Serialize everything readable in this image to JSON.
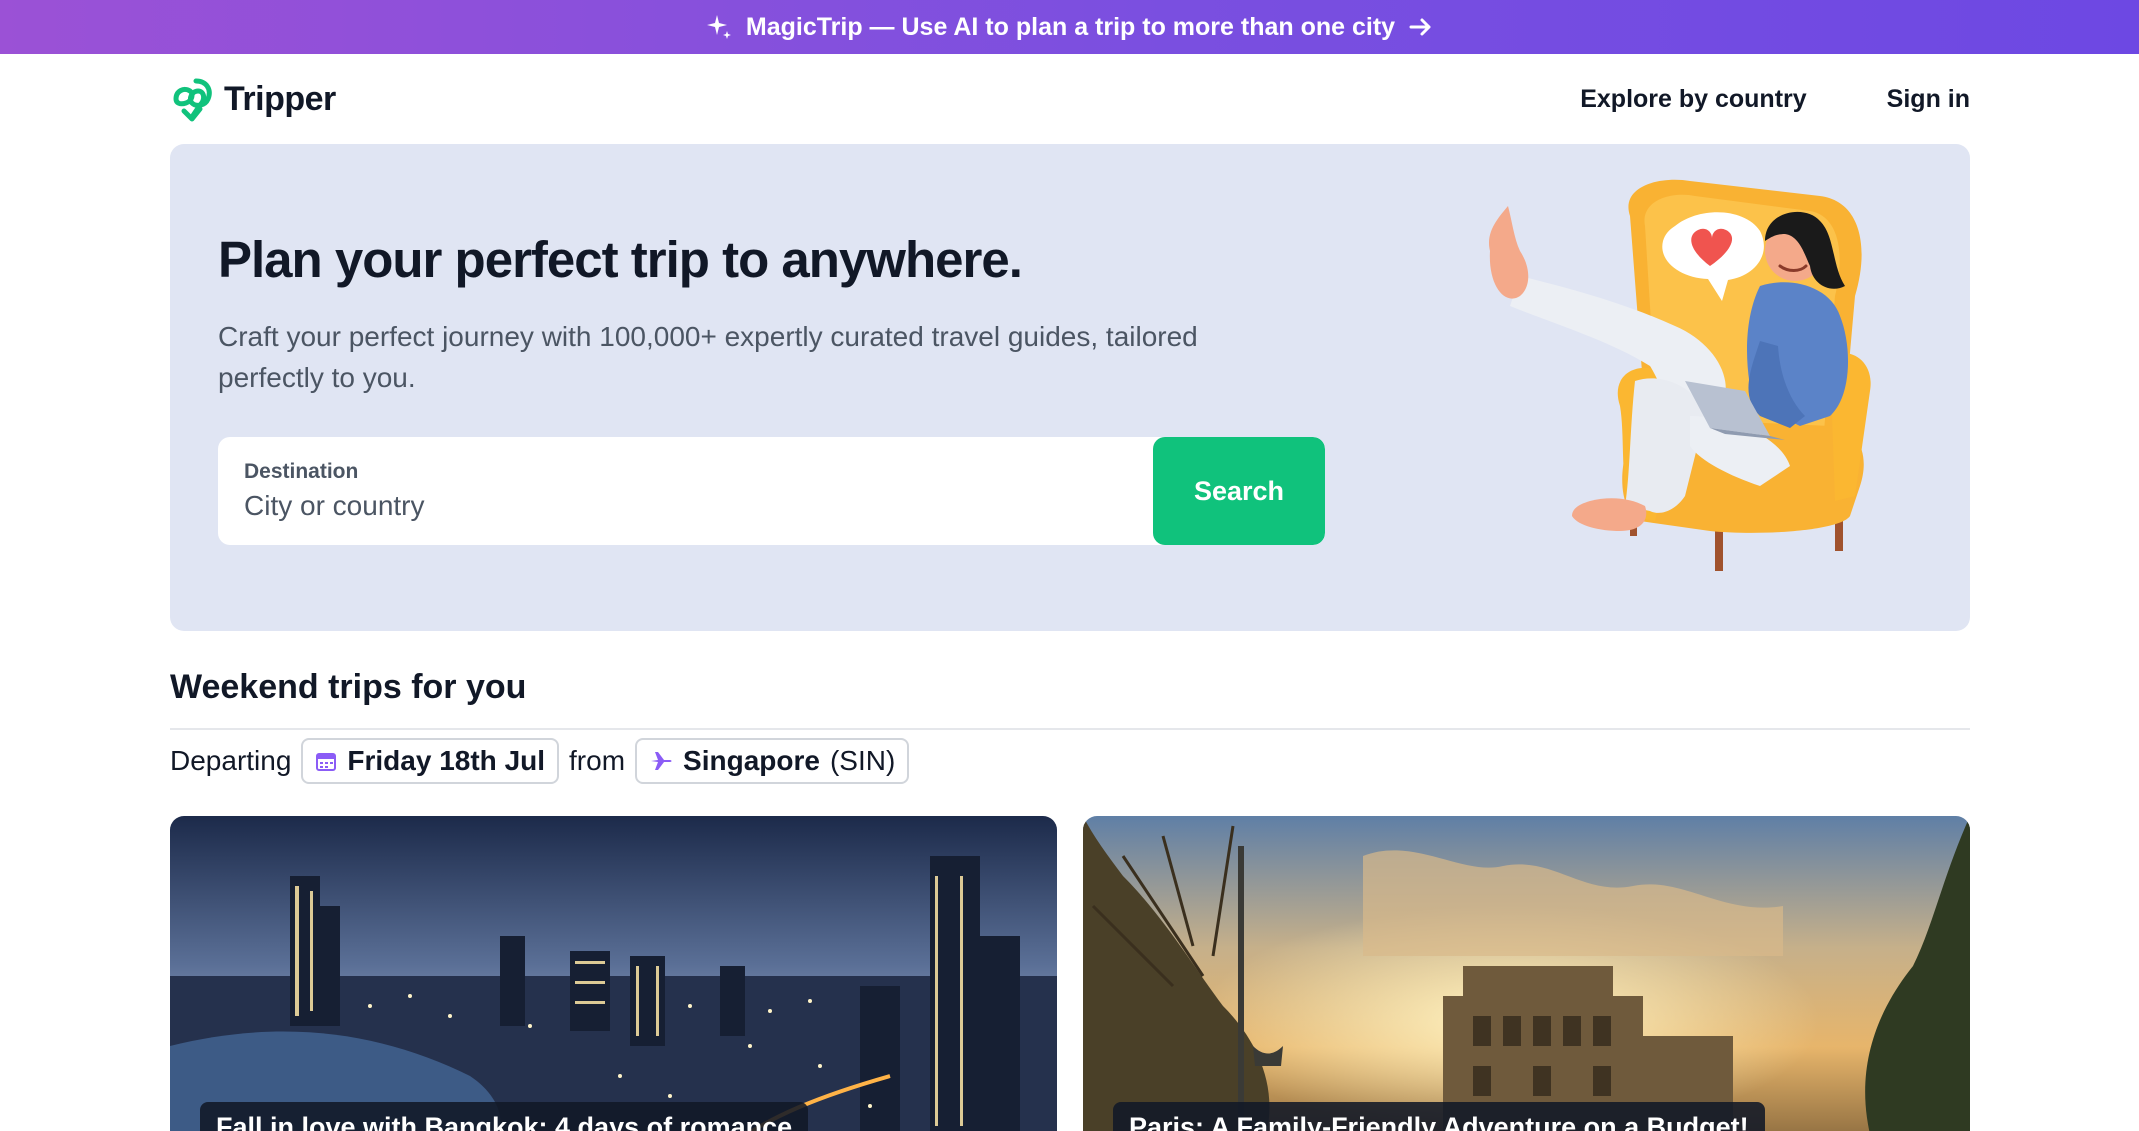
{
  "promo": {
    "text": "MagicTrip — Use AI to plan a trip to more than one city",
    "icon": "sparkle-icon",
    "arrow_icon": "arrow-right-icon"
  },
  "header": {
    "logo_text": "Tripper",
    "nav": {
      "explore": "Explore by country",
      "signin": "Sign in"
    }
  },
  "hero": {
    "title": "Plan your perfect trip to anywhere.",
    "subtitle": "Craft your perfect journey with 100,000+ expertly curated travel guides, tailored perfectly to you.",
    "search": {
      "label": "Destination",
      "placeholder": "City or country",
      "value": "",
      "button": "Search"
    }
  },
  "weekend": {
    "title": "Weekend trips for you",
    "departing_label": "Departing",
    "date": "Friday 18th Jul",
    "from_label": "from",
    "origin_city": "Singapore",
    "origin_code": "(SIN)"
  },
  "cards": [
    {
      "caption": "Fall in love with Bangkok: 4 days of romance"
    },
    {
      "caption": "Paris: A Family-Friendly Adventure on a Budget!"
    }
  ],
  "colors": {
    "brand_green": "#10c27c",
    "promo_purple": "#7a4fe0",
    "hero_bg": "#e0e5f3"
  }
}
